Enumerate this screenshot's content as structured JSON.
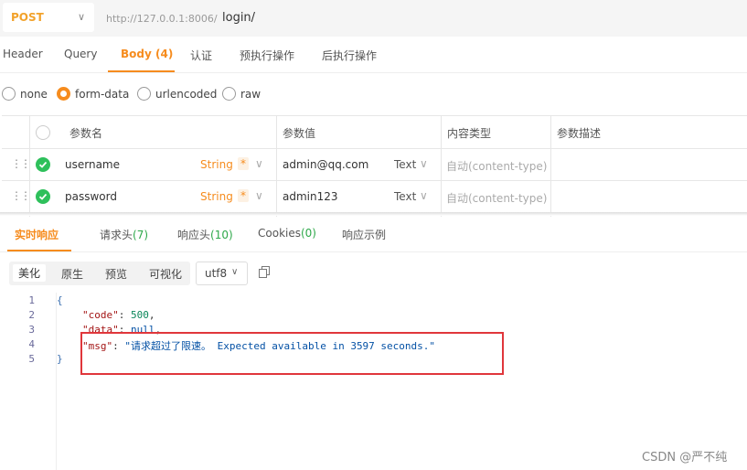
{
  "request": {
    "method": "POST",
    "url_host": "http://127.0.0.1:8006/",
    "url_path": "login/"
  },
  "request_tabs": [
    {
      "label": "Header"
    },
    {
      "label": "Query"
    },
    {
      "label": "Body (4)",
      "active": true
    },
    {
      "label": "认证"
    },
    {
      "label": "预执行操作"
    },
    {
      "label": "后执行操作"
    }
  ],
  "body_types": [
    {
      "label": "none",
      "selected": false
    },
    {
      "label": "form-data",
      "selected": true
    },
    {
      "label": "urlencoded",
      "selected": false
    },
    {
      "label": "raw",
      "selected": false
    }
  ],
  "params_table": {
    "headers": [
      "参数名",
      "参数值",
      "内容类型",
      "参数描述"
    ],
    "rows": [
      {
        "name": "username",
        "type": "String",
        "required": "*",
        "value": "admin@qq.com",
        "value_type": "Text",
        "content_type": "自动(content-type)",
        "description": ""
      },
      {
        "name": "password",
        "type": "String",
        "required": "*",
        "value": "admin123",
        "value_type": "Text",
        "content_type": "自动(content-type)",
        "description": ""
      }
    ]
  },
  "response_tabs": {
    "realtime": "实时响应",
    "req_headers": "请求头",
    "req_headers_count": "(7)",
    "resp_headers": "响应头",
    "resp_headers_count": "(10)",
    "cookies": "Cookies",
    "cookies_count": "(0)",
    "example": "响应示例"
  },
  "format_buttons": [
    {
      "label": "美化",
      "active": true
    },
    {
      "label": "原生"
    },
    {
      "label": "预览"
    },
    {
      "label": "可视化"
    }
  ],
  "encoding": "utf8",
  "response_body": {
    "line_numbers": [
      "1",
      "2",
      "3",
      "4",
      "5"
    ],
    "open_brace": "{",
    "close_brace": "}",
    "code_key": "\"code\"",
    "code_value": "500",
    "data_key": "\"data\"",
    "data_value": "null",
    "msg_key": "\"msg\"",
    "msg_value": "\"请求超过了限速。 Expected available in 3597 seconds.\""
  },
  "colors": {
    "accent": "#f68c1e",
    "success": "#2ec05b",
    "annotation": "#e0363b"
  },
  "watermark": "CSDN @严不纯"
}
